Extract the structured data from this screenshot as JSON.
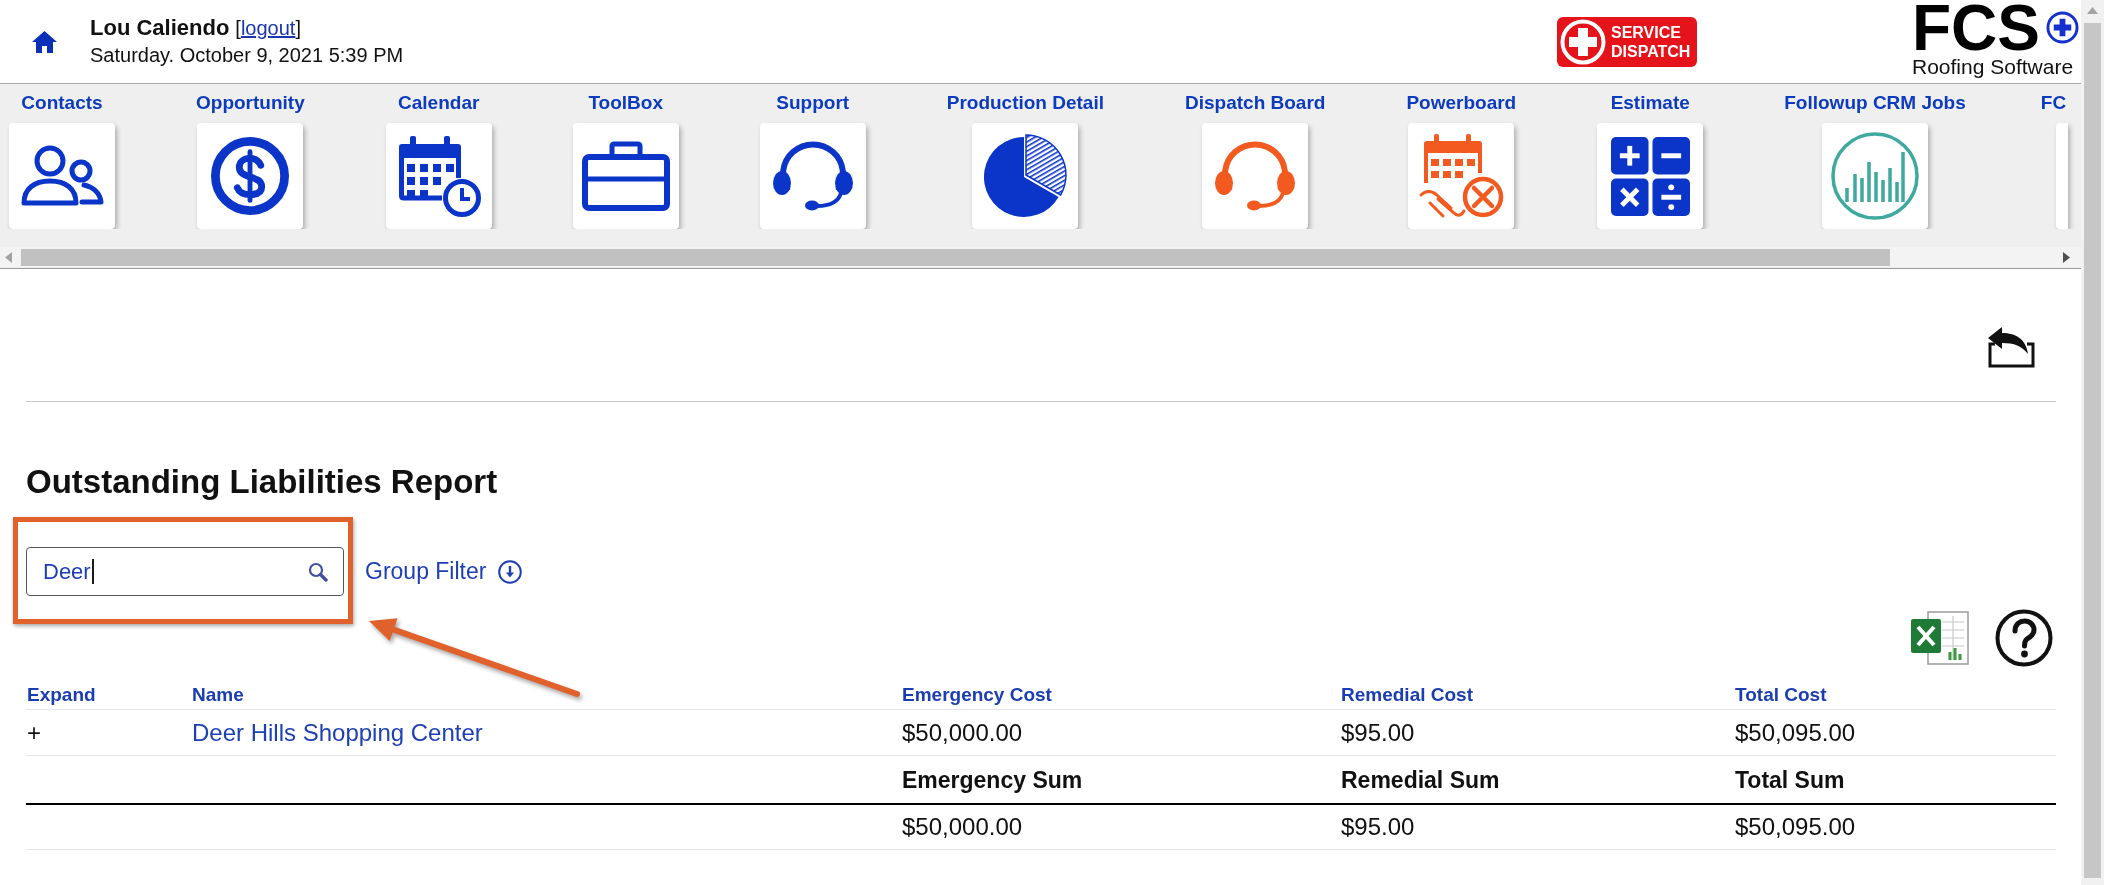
{
  "header": {
    "user_name": "Lou Caliendo",
    "logout": {
      "open": "[",
      "label": "logout",
      "close": "]"
    },
    "datetime": "Saturday. October 9, 2021 5:39 PM"
  },
  "service_dispatch_logo": {
    "lines": [
      "SERVICE",
      "DISPATCH"
    ]
  },
  "brand_logo": {
    "name": "FCS",
    "tagline": "Roofing Software"
  },
  "app_bar": {
    "items": [
      {
        "label": "Contacts",
        "kind": "full"
      },
      {
        "label": "Opportunity",
        "kind": "full"
      },
      {
        "label": "Calendar",
        "kind": "full"
      },
      {
        "label": "ToolBox",
        "kind": "full"
      },
      {
        "label": "Support",
        "kind": "full"
      },
      {
        "label": "Production Detail",
        "kind": "full"
      },
      {
        "label": "Dispatch Board",
        "kind": "full"
      },
      {
        "label": "Powerboard",
        "kind": "full"
      },
      {
        "label": "Estimate",
        "kind": "full"
      },
      {
        "label": "Followup CRM Jobs",
        "kind": "full"
      },
      {
        "label": "FC",
        "kind": "cut"
      }
    ]
  },
  "report": {
    "title": "Outstanding Liabilities Report",
    "search": {
      "value": "Deer",
      "focused": true
    },
    "group_filter": "Group Filter",
    "table": {
      "columns": [
        "Expand",
        "Name",
        "Emergency Cost",
        "Remedial Cost",
        "Total Cost"
      ],
      "rows": [
        {
          "expand": "+",
          "name": "Deer Hills Shopping Center",
          "emergency_cost": "$50,000.00",
          "remedial_cost": "$95.00",
          "total_cost": "$50,095.00"
        }
      ],
      "summary": {
        "labels": [
          "Emergency Sum",
          "Remedial Sum",
          "Total Sum"
        ],
        "values": [
          "$50,000.00",
          "$95.00",
          "$50,095.00"
        ]
      }
    }
  }
}
